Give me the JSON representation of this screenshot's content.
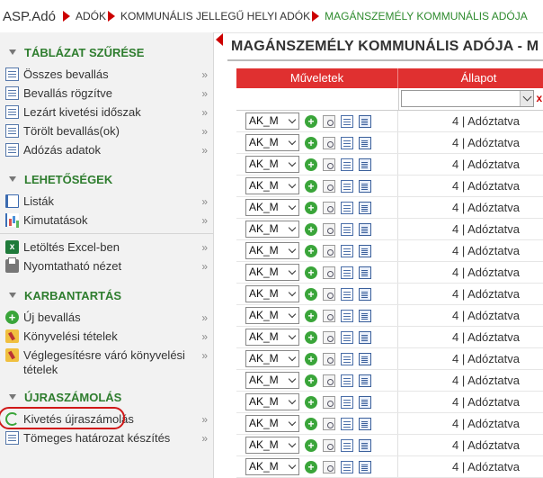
{
  "breadcrumb": {
    "home": "ASP.Adó",
    "items": [
      "ADÓK",
      "KOMMUNÁLIS JELLEGŰ HELYI ADÓK"
    ],
    "current": "MAGÁNSZEMÉLY KOMMUNÁLIS ADÓJA"
  },
  "sidebar": {
    "chevron": "»",
    "sections": [
      {
        "title": "TÁBLÁZAT SZŰRÉSE",
        "items": [
          {
            "label": "Összes bevallás",
            "icon": "document-list-icon"
          },
          {
            "label": "Bevallás rögzítve",
            "icon": "document-list-icon"
          },
          {
            "label": "Lezárt kivetési időszak",
            "icon": "document-list-icon"
          },
          {
            "label": "Törölt bevallás(ok)",
            "icon": "document-list-icon"
          },
          {
            "label": "Adózás adatok",
            "icon": "document-list-icon"
          }
        ]
      },
      {
        "title": "LEHETŐSÉGEK",
        "items": [
          {
            "label": "Listák",
            "icon": "book-icon"
          },
          {
            "label": "Kimutatások",
            "icon": "bar-chart-icon"
          }
        ],
        "extra_items": [
          {
            "label": "Letöltés Excel-ben",
            "icon": "excel-icon"
          },
          {
            "label": "Nyomtatható nézet",
            "icon": "printer-icon"
          }
        ]
      },
      {
        "title": "KARBANTARTÁS",
        "items": [
          {
            "label": "Új bevallás",
            "icon": "add-icon"
          },
          {
            "label": "Könyvelési tételek",
            "icon": "folder-edit-icon"
          },
          {
            "label": "Véglegesítésre váró könyvelési tételek",
            "icon": "folder-edit-icon"
          }
        ]
      },
      {
        "title": "ÚJRASZÁMOLÁS",
        "items": [
          {
            "label": "Kivetés újraszámolás",
            "icon": "refresh-icon"
          },
          {
            "label": "Tömeges határozat készítés",
            "icon": "document-stack-icon"
          }
        ]
      }
    ]
  },
  "main": {
    "title": "MAGÁNSZEMÉLY KOMMUNÁLIS ADÓJA - M",
    "grid": {
      "columns": [
        "Műveletek",
        "Állapot"
      ],
      "filter_clear": "x",
      "row_select_value": "AK_M",
      "rows": [
        "4 | Adóztatva",
        "4 | Adóztatva",
        "4 | Adóztatva",
        "4 | Adóztatva",
        "4 | Adóztatva",
        "4 | Adóztatva",
        "4 | Adóztatva",
        "4 | Adóztatva",
        "4 | Adóztatva",
        "4 | Adóztatva",
        "4 | Adóztatva",
        "4 | Adóztatva",
        "4 | Adóztatva",
        "4 | Adóztatva",
        "4 | Adóztatva",
        "4 | Adóztatva",
        "4 | Adóztatva"
      ]
    }
  },
  "colors": {
    "accent_red": "#cc0000",
    "header_red": "#e03030",
    "section_green": "#2e7d2e",
    "breadcrumb_current": "#2e8b2e"
  }
}
